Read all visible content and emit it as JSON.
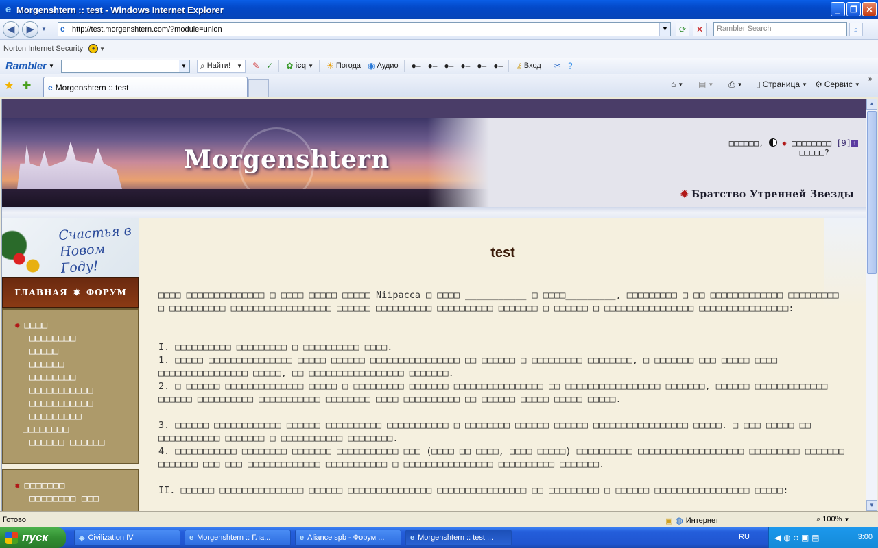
{
  "window": {
    "title": "Morgenshtern :: test - Windows Internet Explorer"
  },
  "address_bar": {
    "url": "http://test.morgenshtern.com/?module=union",
    "search_placeholder": "Rambler Search"
  },
  "norton": {
    "label": "Norton Internet Security"
  },
  "rambler_toolbar": {
    "logo": "Rambler",
    "find_button": "Найти!",
    "icq": "icq",
    "weather": "Погода",
    "audio": "Аудио",
    "login": "Вход"
  },
  "tabs": [
    {
      "label": "Morgenshtern :: test"
    }
  ],
  "command_bar": {
    "page_label": "Страница",
    "tools_label": "Сервис"
  },
  "page": {
    "logo_text": "Morgenshtern",
    "greeting_line1": "□□□□□□,",
    "greeting_name": "□□□□□□□□",
    "greeting_count": "[9]",
    "greeting_line2": "□□□□□?",
    "brotherhood": "Братство Утренней Звезды",
    "new_year_line1": "Счастья в",
    "new_year_line2": "Новом Году!",
    "menu_main": "ГЛАВНАЯ",
    "menu_forum": "ФОРУМ",
    "sidebar_menu1": [
      "□□□□",
      "□□□□□□□□",
      "□□□□□",
      "□□□□□□",
      "□□□□□□□□",
      "□□□□□□□□□□□",
      "□□□□□□□□□□□",
      "□□□□□□□□□",
      "□□□□□□□□",
      "□□□□□□ □□□□□□"
    ],
    "sidebar_menu2": [
      "□□□□□□□",
      "□□□□□□□□ □□□"
    ],
    "title": "test",
    "paragraphs": [
      "□□□□ □□□□□□□□□□□□□□ □ □□□□ □□□□□ □□□□□ Niipacca □ □□□□ ___________ □ □□□□_________, □□□□□□□□□ □ □□ □□□□□□□□□□□□□ □□□□□□□□□ □ □□□□□□□□□□ □□□□□□□□□□□□□□□□□□ □□□□□□ □□□□□□□□□□ □□□□□□□□□□ □□□□□□□ □ □□□□□□ □ □□□□□□□□□□□□□□□□ □□□□□□□□□□□□□□□□:",
      "I. □□□□□□□□□□ □□□□□□□□□ □ □□□□□□□□□□ □□□□.",
      "1. □□□□□ □□□□□□□□□□□□□□□ □□□□□ □□□□□□ □□□□□□□□□□□□□□□□ □□ □□□□□□ □ □□□□□□□□□ □□□□□□□□, □ □□□□□□□ □□□ □□□□□ □□□□ □□□□□□□□□□□□□□□□ □□□□□, □□ □□□□□□□□□□□□□□□□□ □□□□□□□.",
      "2. □ □□□□□□ □□□□□□□□□□□□□□ □□□□□ □ □□□□□□□□□ □□□□□□□ □□□□□□□□□□□□□□□□ □□ □□□□□□□□□□□□□□□□□ □□□□□□□, □□□□□□ □□□□□□□□□□□□□ □□□□□□ □□□□□□□□□□ □□□□□□□□□□□ □□□□□□□□ □□□□ □□□□□□□□□□ □□ □□□□□□ □□□□□ □□□□□ □□□□□.",
      "3. □□□□□□ □□□□□□□□□□□□ □□□□□□ □□□□□□□□□□ □□□□□□□□□□□ □ □□□□□□□□ □□□□□□ □□□□□□ □□□□□□□□□□□□□□□□□ □□□□□. □ □□□ □□□□□ □□ □□□□□□□□□□□ □□□□□□□ □ □□□□□□□□□□□ □□□□□□□□.",
      "4. □□□□□□□□□□□ □□□□□□□□ □□□□□□□ □□□□□□□□□□□ □□□ (□□□□ □□ □□□□, □□□□ □□□□□) □□□□□□□□□□ □□□□□□□□□□□□□□□□□□□ □□□□□□□□□ □□□□□□□ □□□□□□□ □□□ □□□ □□□□□□□□□□□□□ □□□□□□□□□□□ □ □□□□□□□□□□□□□□□□ □□□□□□□□□□ □□□□□□□.",
      "II. □□□□□□ □□□□□□□□□□□□□□□ □□□□□□ □□□□□□□□□□□□□□□ □□□□□□□□□□□□□□□□ □□ □□□□□□□□□ □ □□□□□□ □□□□□□□□□□□□□□□□□ □□□□□:"
    ]
  },
  "status_bar": {
    "status": "Готово",
    "zone": "Интернет",
    "zoom": "100%"
  },
  "taskbar": {
    "start": "пуск",
    "tasks": [
      "Civilization IV",
      "Morgenshtern :: Гла...",
      "Aliance spb - Форум ...",
      "Morgenshtern :: test ..."
    ],
    "lang": "RU",
    "clock": "3:00"
  }
}
